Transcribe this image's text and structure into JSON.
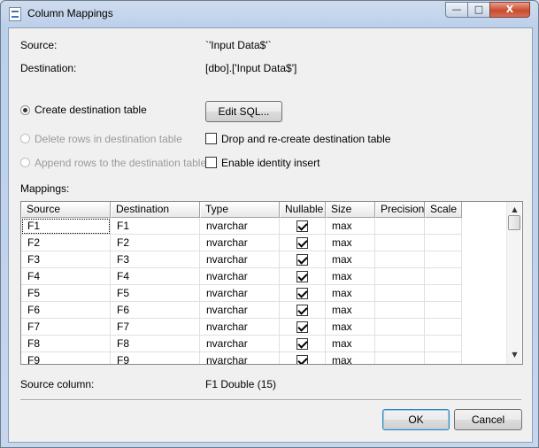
{
  "window": {
    "title": "Column Mappings",
    "caption_buttons": {
      "minimize": "—",
      "maximize": "□",
      "close": "X"
    }
  },
  "source": {
    "label": "Source:",
    "value": "`'Input Data$'`"
  },
  "destination": {
    "label": "Destination:",
    "value": "[dbo].['Input Data$']"
  },
  "options": {
    "create_table": {
      "label": "Create destination table",
      "checked": true
    },
    "delete_rows": {
      "label": "Delete rows in destination table",
      "enabled": false
    },
    "append_rows": {
      "label": "Append rows to the destination table",
      "enabled": false
    },
    "edit_sql_label": "Edit SQL...",
    "drop_recreate": {
      "label": "Drop and re-create destination table",
      "checked": false
    },
    "identity_insert": {
      "label": "Enable identity insert",
      "checked": false
    }
  },
  "mappings": {
    "label": "Mappings:",
    "columns": [
      "Source",
      "Destination",
      "Type",
      "Nullable",
      "Size",
      "Precision",
      "Scale"
    ],
    "rows": [
      {
        "source": "F1",
        "destination": "F1",
        "type": "nvarchar",
        "nullable": true,
        "size": "max",
        "precision": "",
        "scale": ""
      },
      {
        "source": "F2",
        "destination": "F2",
        "type": "nvarchar",
        "nullable": true,
        "size": "max",
        "precision": "",
        "scale": ""
      },
      {
        "source": "F3",
        "destination": "F3",
        "type": "nvarchar",
        "nullable": true,
        "size": "max",
        "precision": "",
        "scale": ""
      },
      {
        "source": "F4",
        "destination": "F4",
        "type": "nvarchar",
        "nullable": true,
        "size": "max",
        "precision": "",
        "scale": ""
      },
      {
        "source": "F5",
        "destination": "F5",
        "type": "nvarchar",
        "nullable": true,
        "size": "max",
        "precision": "",
        "scale": ""
      },
      {
        "source": "F6",
        "destination": "F6",
        "type": "nvarchar",
        "nullable": true,
        "size": "max",
        "precision": "",
        "scale": ""
      },
      {
        "source": "F7",
        "destination": "F7",
        "type": "nvarchar",
        "nullable": true,
        "size": "max",
        "precision": "",
        "scale": ""
      },
      {
        "source": "F8",
        "destination": "F8",
        "type": "nvarchar",
        "nullable": true,
        "size": "max",
        "precision": "",
        "scale": ""
      },
      {
        "source": "F9",
        "destination": "F9",
        "type": "nvarchar",
        "nullable": true,
        "size": "max",
        "precision": "",
        "scale": ""
      }
    ]
  },
  "source_column": {
    "label": "Source column:",
    "value": "F1 Double (15)"
  },
  "buttons": {
    "ok": "OK",
    "cancel": "Cancel"
  }
}
